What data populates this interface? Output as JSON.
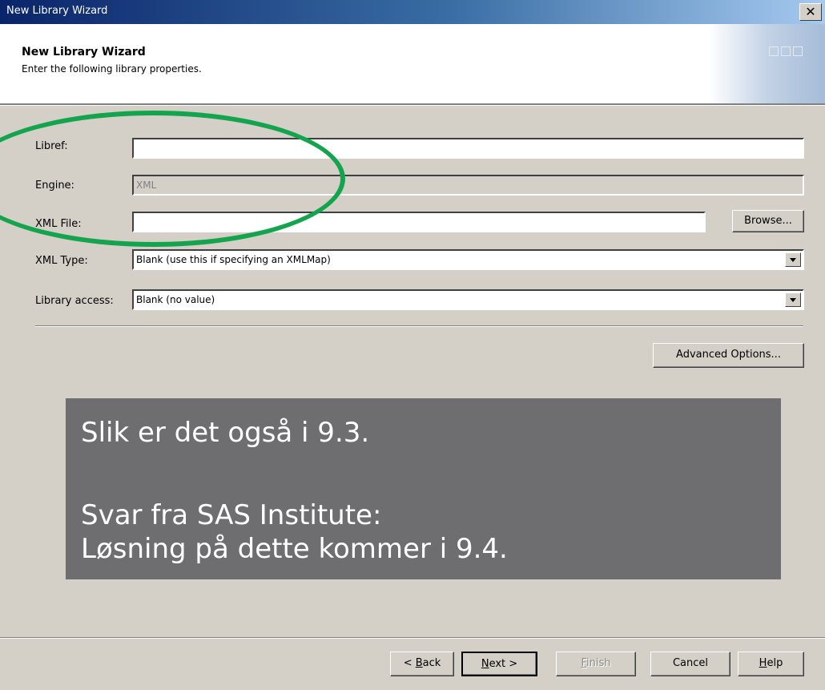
{
  "window": {
    "title": "New Library Wizard",
    "close_glyph": "✕"
  },
  "header": {
    "title": "New Library Wizard",
    "subtitle": "Enter the following library properties."
  },
  "form": {
    "libref": {
      "label": "Libref:",
      "value": ""
    },
    "engine": {
      "label": "Engine:",
      "value": "XML"
    },
    "xml_file": {
      "label": "XML File:",
      "value": "",
      "browse_label": "Browse..."
    },
    "xml_type": {
      "label": "XML Type:",
      "selected": "Blank (use this if specifying an XMLMap)"
    },
    "library_access": {
      "label": "Library access:",
      "selected": "Blank (no value)"
    },
    "advanced_options_label": "Advanced Options..."
  },
  "overlay": {
    "line1": "Slik er det også i 9.3.",
    "line2": "Svar fra SAS Institute:",
    "line3": "Løsning på dette kommer i 9.4."
  },
  "footer": {
    "back": {
      "pre": "< ",
      "key": "B",
      "post": "ack"
    },
    "next": {
      "pre": "",
      "key": "N",
      "post": "ext >"
    },
    "finish": {
      "pre": "",
      "key": "F",
      "post": "inish"
    },
    "cancel": "Cancel",
    "help": {
      "pre": "",
      "key": "H",
      "post": "elp"
    }
  },
  "colors": {
    "highlight_ellipse": "#14a44d",
    "overlay_bg": "#6e6d70",
    "titlebar": "#0a246a"
  }
}
